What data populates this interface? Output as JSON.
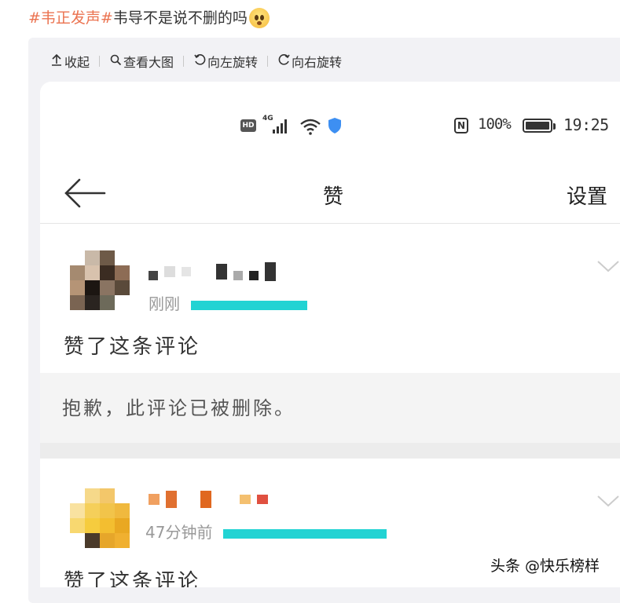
{
  "post": {
    "topic": "#韦正发声#",
    "text": "韦导不是说不删的吗",
    "emoji_icon": "flushed-face-emoji"
  },
  "toolbar": {
    "collapse": "收起",
    "view_large": "查看大图",
    "rotate_left": "向左旋转",
    "rotate_right": "向右旋转"
  },
  "statusbar": {
    "network": "4G",
    "battery_percent": "100%",
    "time": "19:25"
  },
  "nav": {
    "title": "赞",
    "settings": "设置"
  },
  "comments": [
    {
      "time": "刚刚",
      "action": "赞了这条评论",
      "quoted": "抱歉，此评论已被删除。"
    },
    {
      "time": "47分钟前",
      "action": "赞了这条评论"
    }
  ],
  "watermark": "头条 @快乐榜样",
  "colors": {
    "topic": "#eb7350",
    "redaction": "#22d3d3",
    "card_bg": "#f2f2f5"
  }
}
